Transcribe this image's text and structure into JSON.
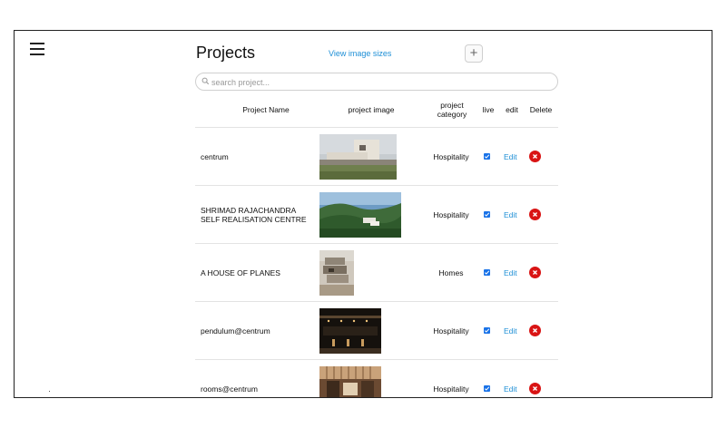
{
  "header": {
    "title": "Projects",
    "view_sizes_link": "View image sizes",
    "add_label": "+"
  },
  "search": {
    "placeholder": "search project..."
  },
  "table": {
    "columns": [
      "Project Name",
      "project image",
      "project category",
      "live",
      "edit",
      "Delete"
    ],
    "rows": [
      {
        "name": "centrum",
        "category": "Hospitality",
        "live": true,
        "edit": "Edit",
        "image": "modern building exterior with landscaped lawn"
      },
      {
        "name": "SHRIMAD RAJACHANDRA SELF REALISATION CENTRE",
        "category": "Hospitality",
        "live": true,
        "edit": "Edit",
        "image": "aerial view of centre among green hills"
      },
      {
        "name": "A HOUSE OF PLANES",
        "category": "Homes",
        "live": true,
        "edit": "Edit",
        "image": "stacked concrete house facade"
      },
      {
        "name": "pendulum@centrum",
        "category": "Hospitality",
        "live": true,
        "edit": "Edit",
        "image": "dark interior with warm ceiling lights"
      },
      {
        "name": "rooms@centrum",
        "category": "Hospitality",
        "live": true,
        "edit": "Edit",
        "image": "hotel room with wooden slatted ceiling"
      }
    ]
  },
  "colors": {
    "link": "#1e8fd6",
    "delete": "#d91414",
    "checkbox": "#1a73e8"
  }
}
